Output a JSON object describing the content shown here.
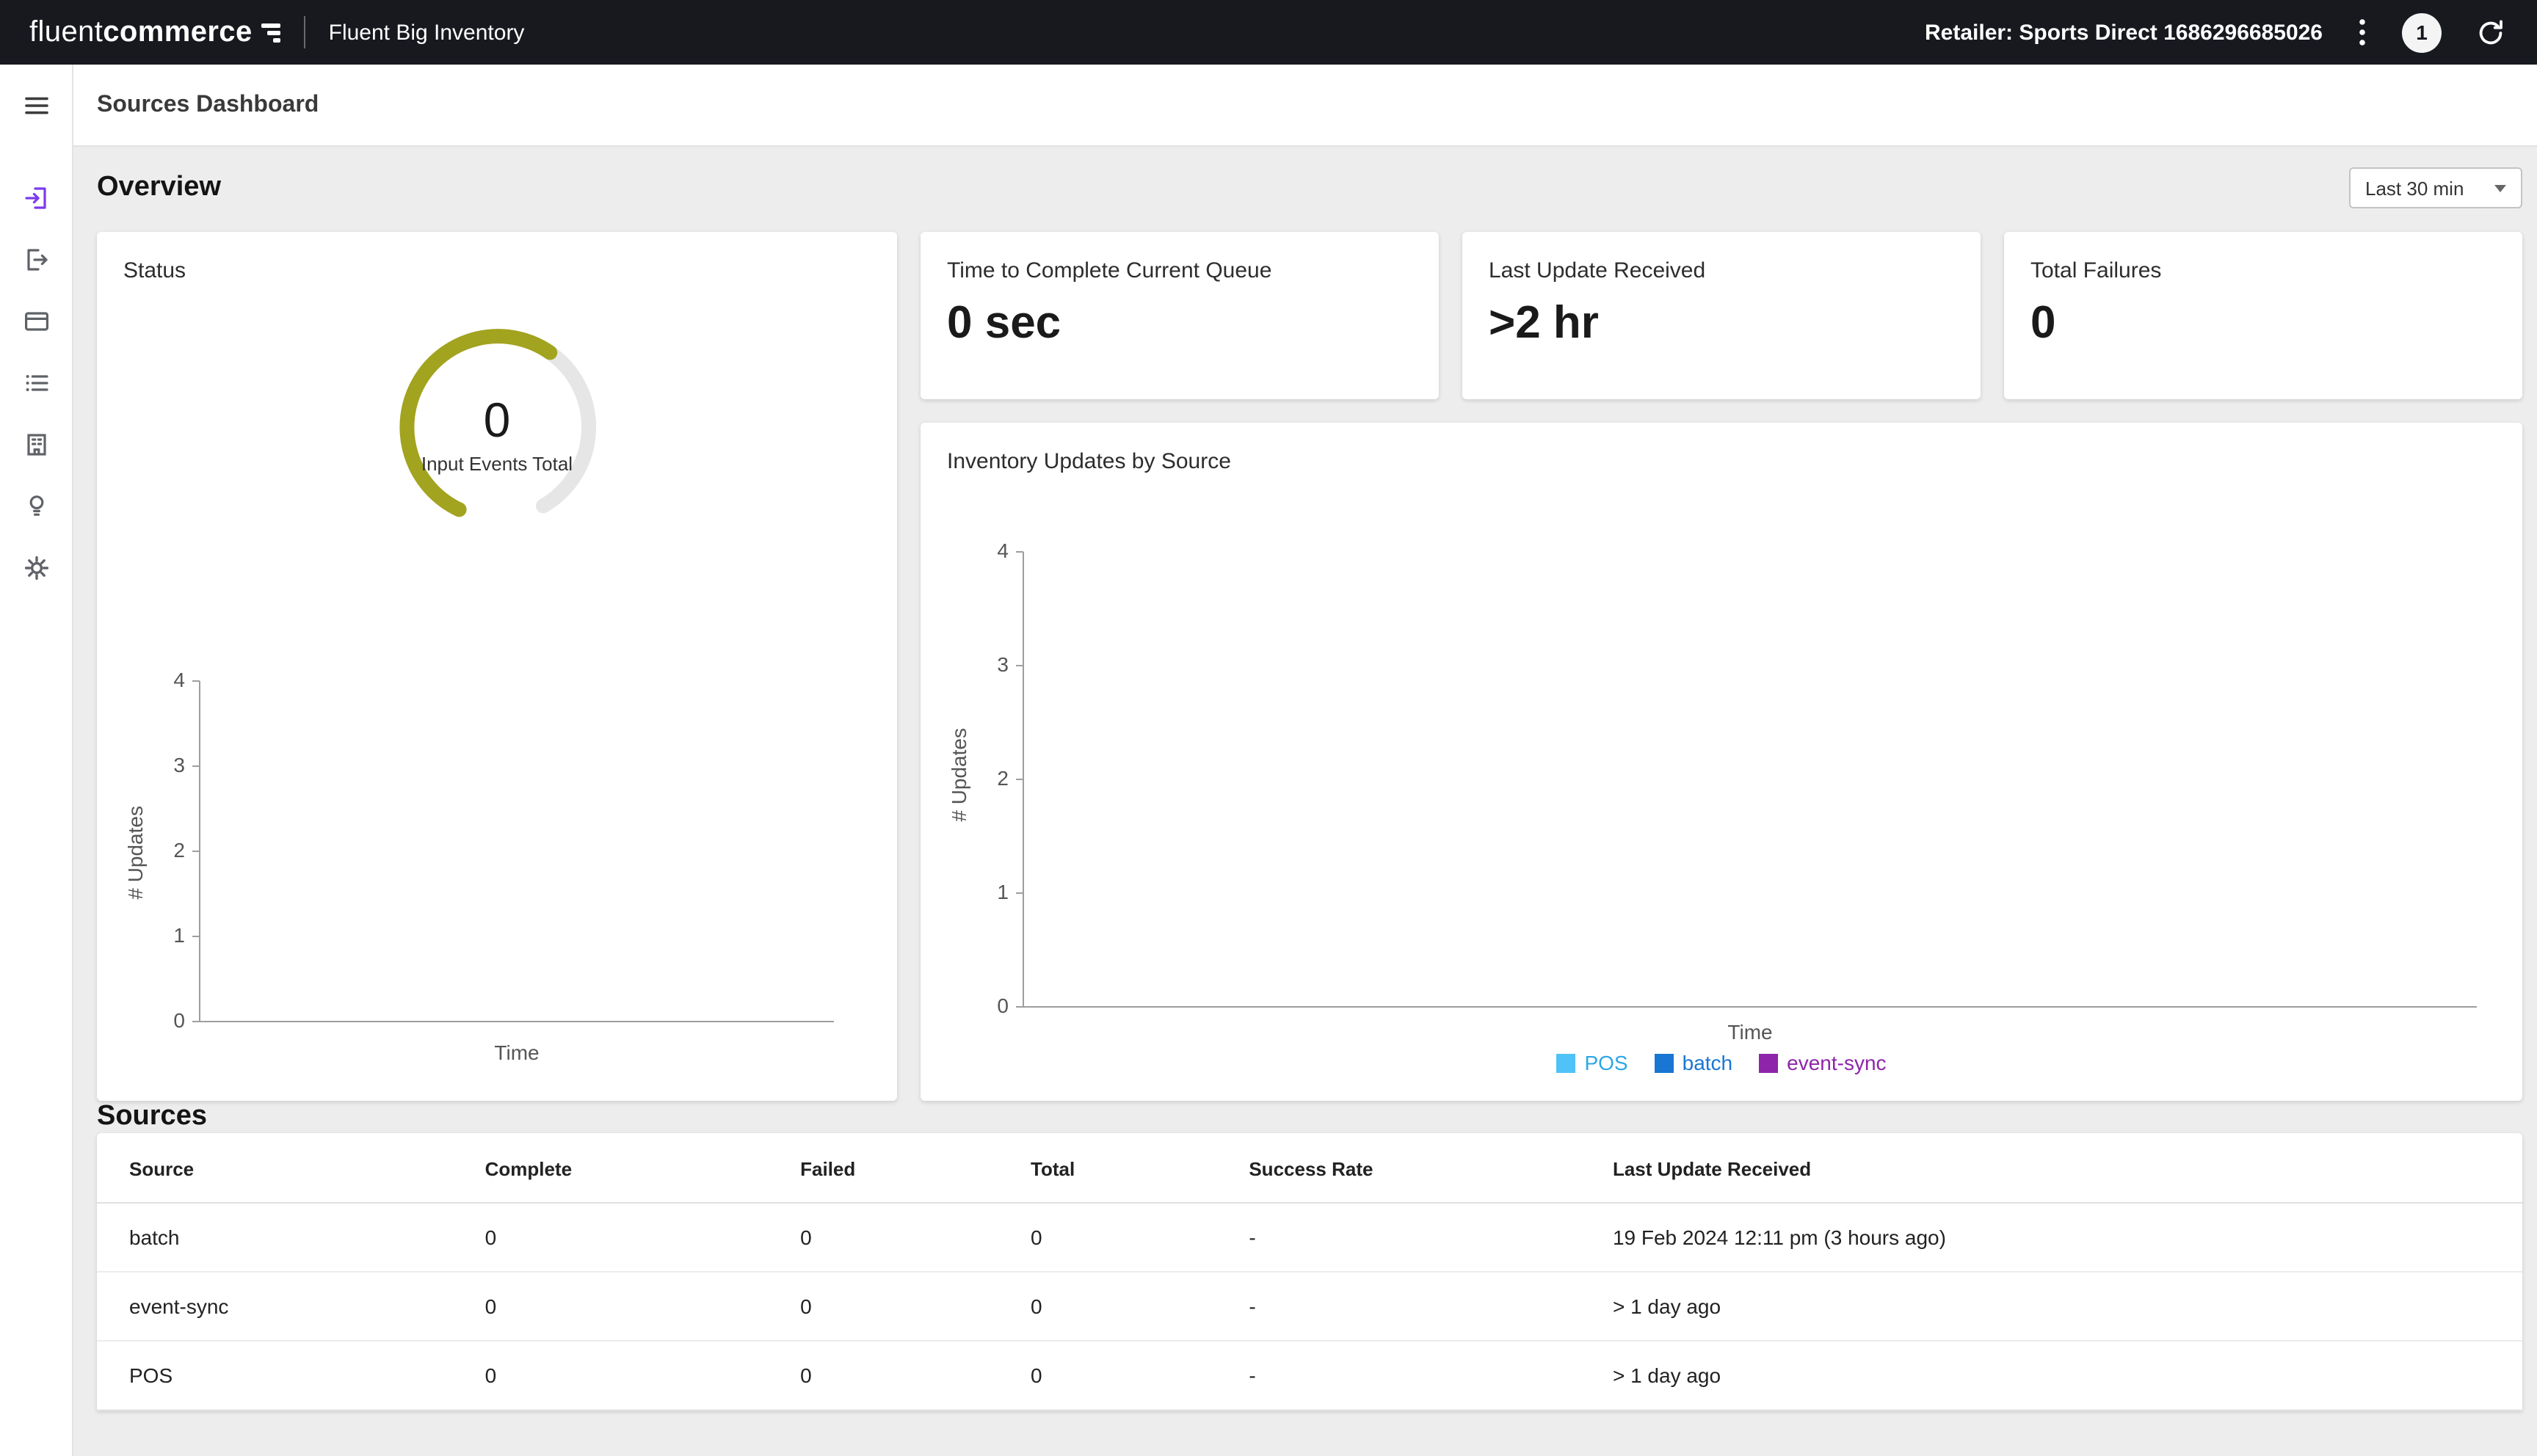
{
  "colors": {
    "topbar_bg": "#17191F",
    "accent_purple": "#7C3AED",
    "gauge_arc": "#A2A31F",
    "gauge_track": "#E6E6E6",
    "legend_pos": "#4FC3F7",
    "legend_batch": "#1976D2",
    "legend_event_sync": "#8E24AA"
  },
  "topbar": {
    "logo_light": "fluent",
    "logo_bold": "commerce",
    "app_title": "Fluent Big Inventory",
    "retailer_label": "Retailer: Sports Direct 1686296685026",
    "badge_count": "1"
  },
  "page": {
    "title": "Sources Dashboard"
  },
  "sidebar": {
    "items": [
      {
        "icon": "menu-icon",
        "active": false
      },
      {
        "icon": "sources-icon",
        "active": true
      },
      {
        "icon": "outputs-icon",
        "active": false
      },
      {
        "icon": "billing-icon",
        "active": false
      },
      {
        "icon": "list-icon",
        "active": false
      },
      {
        "icon": "organization-icon",
        "active": false
      },
      {
        "icon": "insights-icon",
        "active": false
      },
      {
        "icon": "settings-icon",
        "active": false
      }
    ]
  },
  "overview": {
    "heading": "Overview",
    "time_filter_value": "Last 30 min",
    "status_card": {
      "title": "Status",
      "gauge_value": "0",
      "gauge_label": "Input Events Total",
      "chart": {
        "ylabel": "# Updates",
        "xlabel": "Time",
        "yticks": [
          "4",
          "3",
          "2",
          "1",
          "0"
        ]
      }
    },
    "stat_cards": [
      {
        "title": "Time to Complete Current Queue",
        "value": "0 sec"
      },
      {
        "title": "Last Update Received",
        "value": ">2 hr"
      },
      {
        "title": "Total Failures",
        "value": "0"
      }
    ],
    "inventory_card": {
      "title": "Inventory Updates by Source",
      "chart": {
        "ylabel": "# Updates",
        "xlabel": "Time",
        "yticks": [
          "4",
          "3",
          "2",
          "1",
          "0"
        ]
      },
      "legend": [
        {
          "label": "POS",
          "color": "#4FC3F7"
        },
        {
          "label": "batch",
          "color": "#1976D2"
        },
        {
          "label": "event-sync",
          "color": "#8E24AA"
        }
      ]
    }
  },
  "sources": {
    "heading": "Sources",
    "table": {
      "columns": [
        "Source",
        "Complete",
        "Failed",
        "Total",
        "Success Rate",
        "Last Update Received"
      ],
      "rows": [
        [
          "batch",
          "0",
          "0",
          "0",
          "-",
          "19 Feb 2024 12:11 pm (3 hours ago)"
        ],
        [
          "event-sync",
          "0",
          "0",
          "0",
          "-",
          "> 1 day ago"
        ],
        [
          "POS",
          "0",
          "0",
          "0",
          "-",
          "> 1 day ago"
        ]
      ]
    }
  },
  "chart_data": [
    {
      "type": "gauge",
      "title": "Status",
      "value": 0,
      "label": "Input Events Total"
    },
    {
      "type": "line",
      "title": "Status - updates over time",
      "xlabel": "Time",
      "ylabel": "# Updates",
      "ylim": [
        0,
        4
      ],
      "yticks": [
        0,
        1,
        2,
        3,
        4
      ],
      "series": []
    },
    {
      "type": "line",
      "title": "Inventory Updates by Source",
      "xlabel": "Time",
      "ylabel": "# Updates",
      "ylim": [
        0,
        4
      ],
      "yticks": [
        0,
        1,
        2,
        3,
        4
      ],
      "legend_position": "bottom",
      "series": [
        {
          "name": "POS",
          "color": "#4FC3F7",
          "values": []
        },
        {
          "name": "batch",
          "color": "#1976D2",
          "values": []
        },
        {
          "name": "event-sync",
          "color": "#8E24AA",
          "values": []
        }
      ]
    }
  ]
}
